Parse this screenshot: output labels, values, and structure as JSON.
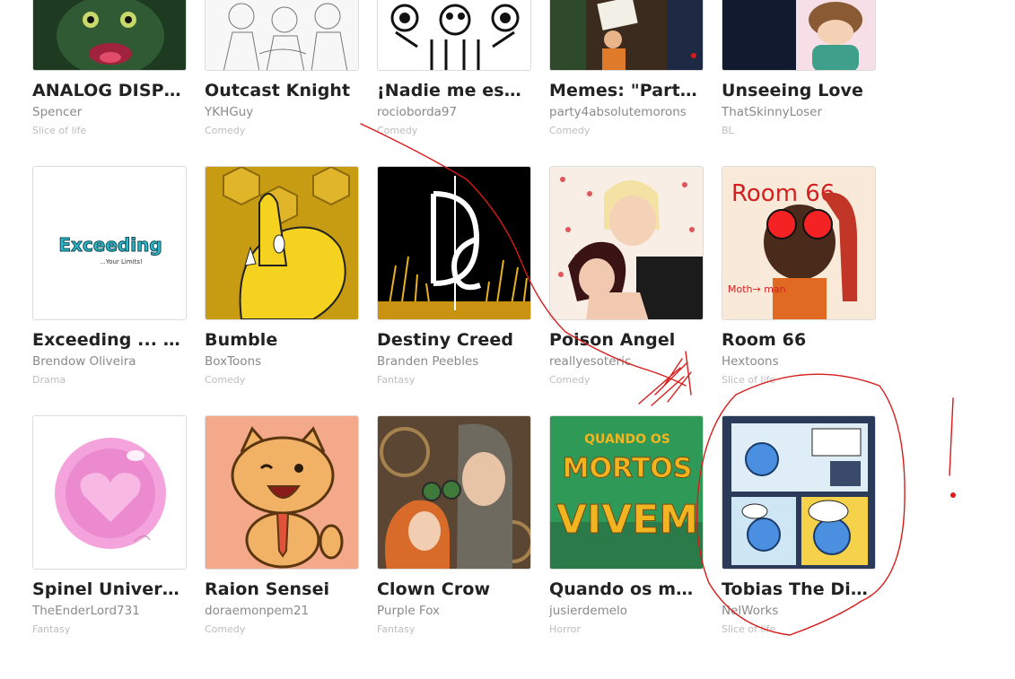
{
  "cards": [
    {
      "title": "ANALOG DISPLA...",
      "author": "Spencer",
      "genre": "Slice of life",
      "cover": "analog-display-cover"
    },
    {
      "title": "Outcast Knight",
      "author": "YKHGuy",
      "genre": "Comedy",
      "cover": "outcast-knight-cover"
    },
    {
      "title": "¡Nadie me escuc...",
      "author": "rocioborda97",
      "genre": "Comedy",
      "cover": "nadie-me-escucha-cover"
    },
    {
      "title": "Memes: \"Party f...",
      "author": "party4absolutemorons",
      "genre": "Comedy",
      "cover": "memes-party-cover"
    },
    {
      "title": "Unseeing Love",
      "author": "ThatSkinnyLoser",
      "genre": "BL",
      "cover": "unseeing-love-cover"
    },
    {
      "title": "Exceeding ... You...",
      "author": "Brendow Oliveira",
      "genre": "Drama",
      "cover": "exceeding-cover",
      "cover_text": "Exceeding",
      "cover_subtext": "...Your Limits!"
    },
    {
      "title": "Bumble",
      "author": "BoxToons",
      "genre": "Comedy",
      "cover": "bumble-cover"
    },
    {
      "title": "Destiny Creed",
      "author": "Branden Peebles",
      "genre": "Fantasy",
      "cover": "destiny-creed-cover"
    },
    {
      "title": "Poison Angel",
      "author": "reallyesoteric",
      "genre": "Comedy",
      "cover": "poison-angel-cover"
    },
    {
      "title": "Room 66",
      "author": "Hextoons",
      "genre": "Slice of life",
      "cover": "room-66-cover",
      "cover_text": "Room 66",
      "cover_subtext": "Moth→ man"
    },
    {
      "title": "Spinel Universe ...",
      "author": "TheEnderLord731",
      "genre": "Fantasy",
      "cover": "spinel-universe-cover"
    },
    {
      "title": "Raion Sensei",
      "author": "doraemonpem21",
      "genre": "Comedy",
      "cover": "raion-sensei-cover"
    },
    {
      "title": "Clown Crow",
      "author": "Purple Fox",
      "genre": "Fantasy",
      "cover": "clown-crow-cover"
    },
    {
      "title": "Quando os mort...",
      "author": "jusierdemelo",
      "genre": "Horror",
      "cover": "quando-os-mortos-cover",
      "cover_text": "QUANDO OS MORTOS VIVEM"
    },
    {
      "title": "Tobias The DigiB...",
      "author": "NelWorks",
      "genre": "Slice of life",
      "cover": "tobias-cover"
    }
  ],
  "colors": {
    "annotation_red": "#d81b1b",
    "title_text": "#222222",
    "author_text": "#8a8a8a",
    "genre_text": "#bdbdbd"
  }
}
